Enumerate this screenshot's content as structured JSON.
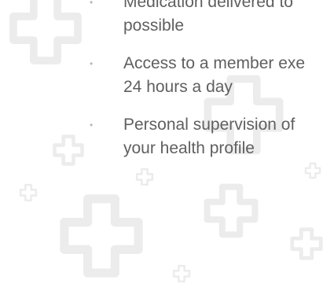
{
  "benefits": [
    {
      "lines": [
        "Medication delivered to",
        "possible"
      ]
    },
    {
      "lines": [
        "Access to a member exe",
        "24 hours a day"
      ]
    },
    {
      "lines": [
        "Personal supervision of",
        "your health profile"
      ]
    }
  ],
  "bullet_glyph": "•",
  "colors": {
    "text": "#5f5f5f",
    "bullet": "#b9b9b9",
    "decor_cross": "#ececec",
    "background": "#ffffff"
  },
  "decor_icon": "medical-cross-outline-icon"
}
